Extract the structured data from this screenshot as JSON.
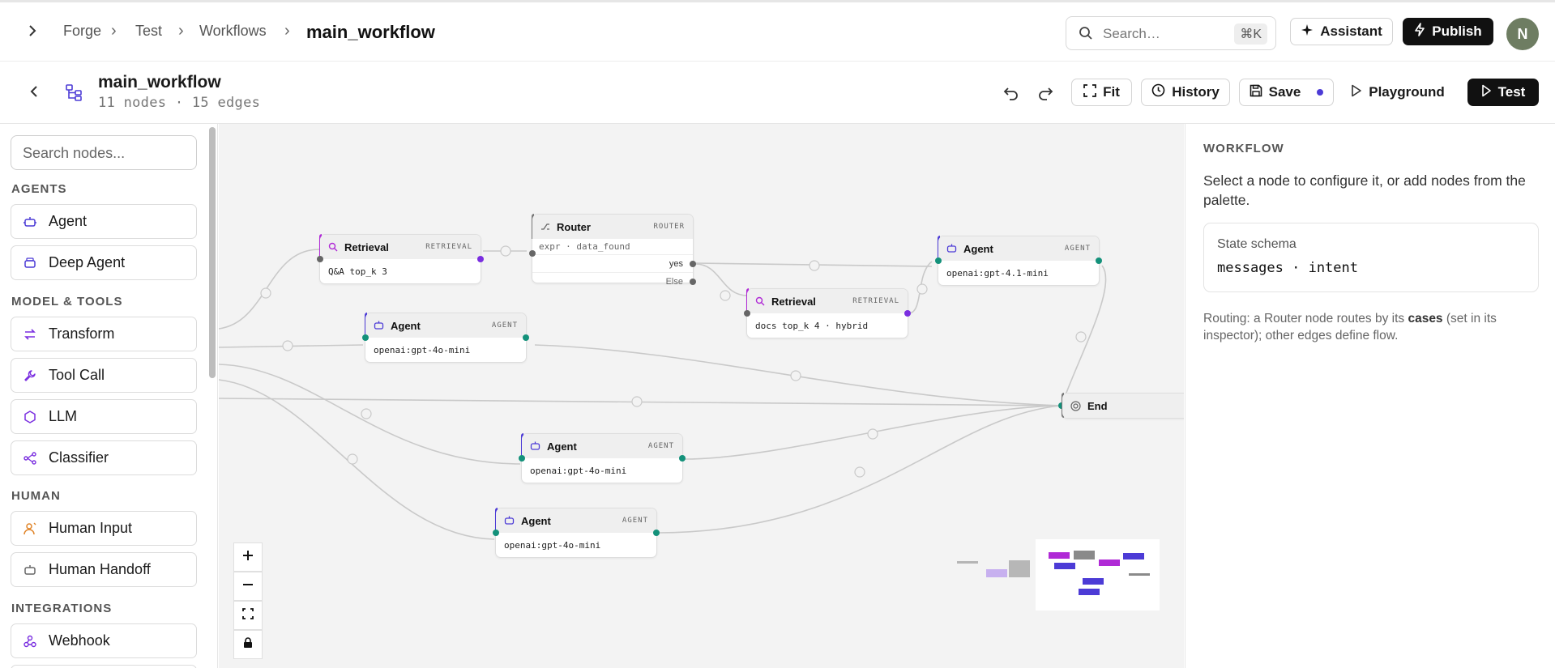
{
  "breadcrumb": {
    "items": [
      "Forge",
      "Test",
      "Workflows"
    ],
    "current": "main_workflow"
  },
  "search": {
    "placeholder": "Search…",
    "shortcut": "⌘K"
  },
  "header_actions": {
    "assistant": "Assistant",
    "publish": "Publish",
    "avatar_initial": "N"
  },
  "workflow": {
    "title": "main_workflow",
    "meta": "11 nodes · 15 edges"
  },
  "toolbar": {
    "fit": "Fit",
    "history": "History",
    "save": "Save",
    "playground": "Playground",
    "test": "Test"
  },
  "sidebar": {
    "search_placeholder": "Search nodes...",
    "groups": [
      {
        "title": "AGENTS",
        "items": [
          "Agent",
          "Deep Agent"
        ]
      },
      {
        "title": "MODEL & TOOLS",
        "items": [
          "Transform",
          "Tool Call",
          "LLM",
          "Classifier"
        ]
      },
      {
        "title": "HUMAN",
        "items": [
          "Human Input",
          "Human Handoff"
        ]
      },
      {
        "title": "INTEGRATIONS",
        "items": [
          "Webhook"
        ]
      }
    ]
  },
  "nodes": [
    {
      "id": "retrieval-1",
      "title": "Retrieval",
      "tag": "RETRIEVAL",
      "body": "Q&A top_k 3",
      "color": "#b02ad6"
    },
    {
      "id": "router",
      "title": "Router",
      "tag": "ROUTER",
      "body": "expr · data_found",
      "cases": [
        "yes",
        "Else"
      ],
      "color": "#777777"
    },
    {
      "id": "agent-1",
      "title": "Agent",
      "tag": "AGENT",
      "body": "openai:gpt-4.1-mini",
      "color": "#4c3bd6"
    },
    {
      "id": "retrieval-2",
      "title": "Retrieval",
      "tag": "RETRIEVAL",
      "body": "docs top_k 4 · hybrid",
      "color": "#b02ad6"
    },
    {
      "id": "agent-2",
      "title": "Agent",
      "tag": "AGENT",
      "body": "openai:gpt-4o-mini",
      "color": "#4c3bd6"
    },
    {
      "id": "end",
      "title": "End",
      "color": "#777777"
    },
    {
      "id": "agent-3",
      "title": "Agent",
      "tag": "AGENT",
      "body": "openai:gpt-4o-mini",
      "color": "#4c3bd6"
    },
    {
      "id": "agent-4",
      "title": "Agent",
      "tag": "AGENT",
      "body": "openai:gpt-4o-mini",
      "color": "#4c3bd6"
    }
  ],
  "inspector": {
    "heading": "WORKFLOW",
    "description": "Select a node to configure it, or add nodes from the palette.",
    "schema_title": "State schema",
    "schema_value": "messages · intent",
    "note_prefix": "Routing: a Router node routes by its ",
    "note_bold": "cases",
    "note_suffix": " (set in its inspector); other edges define flow."
  },
  "colors": {
    "agent": "#4c3bd6",
    "retrieval": "#b02ad6",
    "port_green": "#13917a",
    "port_purple": "#7a2ee0",
    "human": "#e0852a"
  }
}
